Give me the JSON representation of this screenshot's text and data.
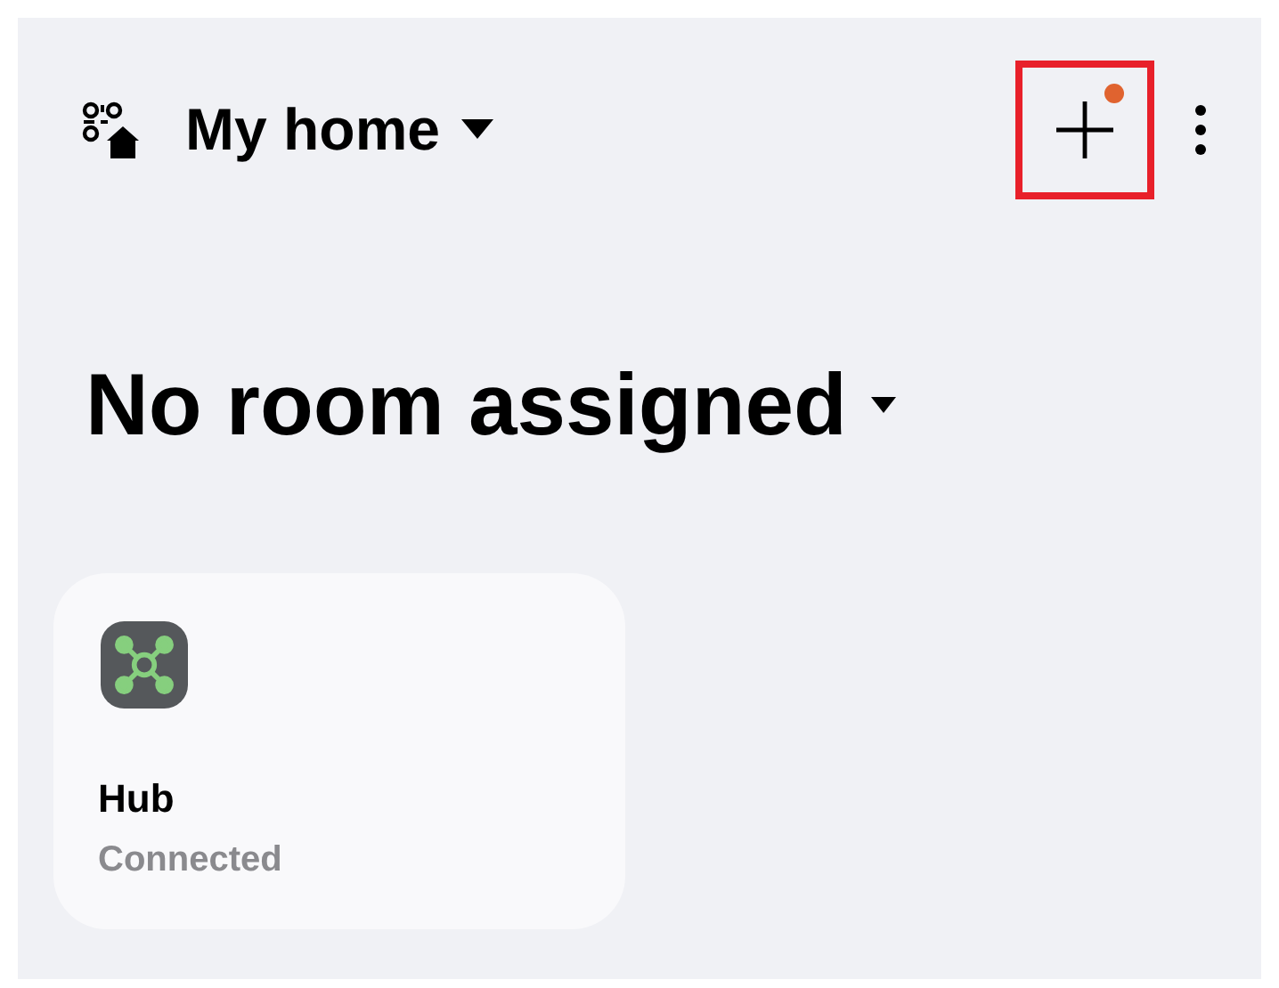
{
  "header": {
    "home_name": "My home",
    "add_button": {
      "notification_dot": true,
      "highlighted": true
    }
  },
  "room": {
    "title": "No room assigned"
  },
  "devices": [
    {
      "kind": "hub",
      "name": "Hub",
      "status": "Connected"
    }
  ]
}
